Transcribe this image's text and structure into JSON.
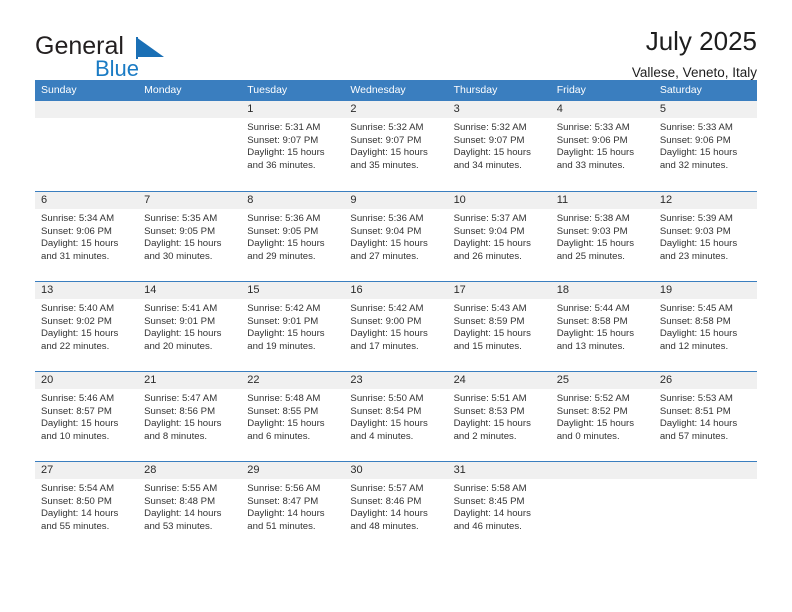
{
  "brand": {
    "name_part1": "General",
    "name_part2": "Blue",
    "flag_color": "#1a6fb5"
  },
  "header": {
    "title": "July 2025",
    "subtitle": "Vallese, Veneto, Italy"
  },
  "theme": {
    "header_blue": "#3a7ebf",
    "day_band_gray": "#f0f0f0",
    "text_color": "#333333"
  },
  "weekdays": [
    "Sunday",
    "Monday",
    "Tuesday",
    "Wednesday",
    "Thursday",
    "Friday",
    "Saturday"
  ],
  "weeks": [
    [
      {
        "day": "",
        "sunrise": "",
        "sunset": "",
        "daylight_line1": "",
        "daylight_line2": "",
        "empty": true
      },
      {
        "day": "",
        "sunrise": "",
        "sunset": "",
        "daylight_line1": "",
        "daylight_line2": "",
        "empty": true
      },
      {
        "day": "1",
        "sunrise": "Sunrise: 5:31 AM",
        "sunset": "Sunset: 9:07 PM",
        "daylight_line1": "Daylight: 15 hours",
        "daylight_line2": "and 36 minutes."
      },
      {
        "day": "2",
        "sunrise": "Sunrise: 5:32 AM",
        "sunset": "Sunset: 9:07 PM",
        "daylight_line1": "Daylight: 15 hours",
        "daylight_line2": "and 35 minutes."
      },
      {
        "day": "3",
        "sunrise": "Sunrise: 5:32 AM",
        "sunset": "Sunset: 9:07 PM",
        "daylight_line1": "Daylight: 15 hours",
        "daylight_line2": "and 34 minutes."
      },
      {
        "day": "4",
        "sunrise": "Sunrise: 5:33 AM",
        "sunset": "Sunset: 9:06 PM",
        "daylight_line1": "Daylight: 15 hours",
        "daylight_line2": "and 33 minutes."
      },
      {
        "day": "5",
        "sunrise": "Sunrise: 5:33 AM",
        "sunset": "Sunset: 9:06 PM",
        "daylight_line1": "Daylight: 15 hours",
        "daylight_line2": "and 32 minutes."
      }
    ],
    [
      {
        "day": "6",
        "sunrise": "Sunrise: 5:34 AM",
        "sunset": "Sunset: 9:06 PM",
        "daylight_line1": "Daylight: 15 hours",
        "daylight_line2": "and 31 minutes."
      },
      {
        "day": "7",
        "sunrise": "Sunrise: 5:35 AM",
        "sunset": "Sunset: 9:05 PM",
        "daylight_line1": "Daylight: 15 hours",
        "daylight_line2": "and 30 minutes."
      },
      {
        "day": "8",
        "sunrise": "Sunrise: 5:36 AM",
        "sunset": "Sunset: 9:05 PM",
        "daylight_line1": "Daylight: 15 hours",
        "daylight_line2": "and 29 minutes."
      },
      {
        "day": "9",
        "sunrise": "Sunrise: 5:36 AM",
        "sunset": "Sunset: 9:04 PM",
        "daylight_line1": "Daylight: 15 hours",
        "daylight_line2": "and 27 minutes."
      },
      {
        "day": "10",
        "sunrise": "Sunrise: 5:37 AM",
        "sunset": "Sunset: 9:04 PM",
        "daylight_line1": "Daylight: 15 hours",
        "daylight_line2": "and 26 minutes."
      },
      {
        "day": "11",
        "sunrise": "Sunrise: 5:38 AM",
        "sunset": "Sunset: 9:03 PM",
        "daylight_line1": "Daylight: 15 hours",
        "daylight_line2": "and 25 minutes."
      },
      {
        "day": "12",
        "sunrise": "Sunrise: 5:39 AM",
        "sunset": "Sunset: 9:03 PM",
        "daylight_line1": "Daylight: 15 hours",
        "daylight_line2": "and 23 minutes."
      }
    ],
    [
      {
        "day": "13",
        "sunrise": "Sunrise: 5:40 AM",
        "sunset": "Sunset: 9:02 PM",
        "daylight_line1": "Daylight: 15 hours",
        "daylight_line2": "and 22 minutes."
      },
      {
        "day": "14",
        "sunrise": "Sunrise: 5:41 AM",
        "sunset": "Sunset: 9:01 PM",
        "daylight_line1": "Daylight: 15 hours",
        "daylight_line2": "and 20 minutes."
      },
      {
        "day": "15",
        "sunrise": "Sunrise: 5:42 AM",
        "sunset": "Sunset: 9:01 PM",
        "daylight_line1": "Daylight: 15 hours",
        "daylight_line2": "and 19 minutes."
      },
      {
        "day": "16",
        "sunrise": "Sunrise: 5:42 AM",
        "sunset": "Sunset: 9:00 PM",
        "daylight_line1": "Daylight: 15 hours",
        "daylight_line2": "and 17 minutes."
      },
      {
        "day": "17",
        "sunrise": "Sunrise: 5:43 AM",
        "sunset": "Sunset: 8:59 PM",
        "daylight_line1": "Daylight: 15 hours",
        "daylight_line2": "and 15 minutes."
      },
      {
        "day": "18",
        "sunrise": "Sunrise: 5:44 AM",
        "sunset": "Sunset: 8:58 PM",
        "daylight_line1": "Daylight: 15 hours",
        "daylight_line2": "and 13 minutes."
      },
      {
        "day": "19",
        "sunrise": "Sunrise: 5:45 AM",
        "sunset": "Sunset: 8:58 PM",
        "daylight_line1": "Daylight: 15 hours",
        "daylight_line2": "and 12 minutes."
      }
    ],
    [
      {
        "day": "20",
        "sunrise": "Sunrise: 5:46 AM",
        "sunset": "Sunset: 8:57 PM",
        "daylight_line1": "Daylight: 15 hours",
        "daylight_line2": "and 10 minutes."
      },
      {
        "day": "21",
        "sunrise": "Sunrise: 5:47 AM",
        "sunset": "Sunset: 8:56 PM",
        "daylight_line1": "Daylight: 15 hours",
        "daylight_line2": "and 8 minutes."
      },
      {
        "day": "22",
        "sunrise": "Sunrise: 5:48 AM",
        "sunset": "Sunset: 8:55 PM",
        "daylight_line1": "Daylight: 15 hours",
        "daylight_line2": "and 6 minutes."
      },
      {
        "day": "23",
        "sunrise": "Sunrise: 5:50 AM",
        "sunset": "Sunset: 8:54 PM",
        "daylight_line1": "Daylight: 15 hours",
        "daylight_line2": "and 4 minutes."
      },
      {
        "day": "24",
        "sunrise": "Sunrise: 5:51 AM",
        "sunset": "Sunset: 8:53 PM",
        "daylight_line1": "Daylight: 15 hours",
        "daylight_line2": "and 2 minutes."
      },
      {
        "day": "25",
        "sunrise": "Sunrise: 5:52 AM",
        "sunset": "Sunset: 8:52 PM",
        "daylight_line1": "Daylight: 15 hours",
        "daylight_line2": "and 0 minutes."
      },
      {
        "day": "26",
        "sunrise": "Sunrise: 5:53 AM",
        "sunset": "Sunset: 8:51 PM",
        "daylight_line1": "Daylight: 14 hours",
        "daylight_line2": "and 57 minutes."
      }
    ],
    [
      {
        "day": "27",
        "sunrise": "Sunrise: 5:54 AM",
        "sunset": "Sunset: 8:50 PM",
        "daylight_line1": "Daylight: 14 hours",
        "daylight_line2": "and 55 minutes."
      },
      {
        "day": "28",
        "sunrise": "Sunrise: 5:55 AM",
        "sunset": "Sunset: 8:48 PM",
        "daylight_line1": "Daylight: 14 hours",
        "daylight_line2": "and 53 minutes."
      },
      {
        "day": "29",
        "sunrise": "Sunrise: 5:56 AM",
        "sunset": "Sunset: 8:47 PM",
        "daylight_line1": "Daylight: 14 hours",
        "daylight_line2": "and 51 minutes."
      },
      {
        "day": "30",
        "sunrise": "Sunrise: 5:57 AM",
        "sunset": "Sunset: 8:46 PM",
        "daylight_line1": "Daylight: 14 hours",
        "daylight_line2": "and 48 minutes."
      },
      {
        "day": "31",
        "sunrise": "Sunrise: 5:58 AM",
        "sunset": "Sunset: 8:45 PM",
        "daylight_line1": "Daylight: 14 hours",
        "daylight_line2": "and 46 minutes."
      },
      {
        "day": "",
        "sunrise": "",
        "sunset": "",
        "daylight_line1": "",
        "daylight_line2": "",
        "empty": true
      },
      {
        "day": "",
        "sunrise": "",
        "sunset": "",
        "daylight_line1": "",
        "daylight_line2": "",
        "empty": true
      }
    ]
  ]
}
